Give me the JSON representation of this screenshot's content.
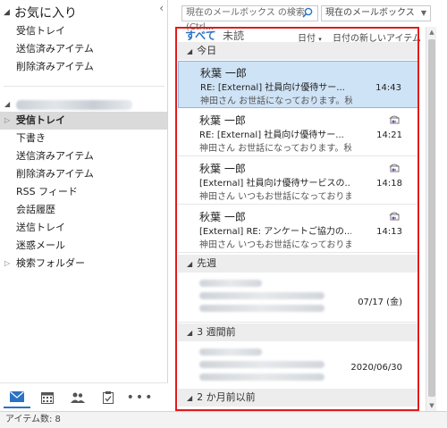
{
  "favorites": {
    "header": "お気に入り",
    "items": [
      "受信トレイ",
      "送信済みアイテム",
      "削除済みアイテム"
    ]
  },
  "folders": {
    "items": [
      "受信トレイ",
      "下書き",
      "送信済みアイテム",
      "削除済みアイテム",
      "RSS フィード",
      "会話履歴",
      "送信トレイ",
      "迷惑メール",
      "検索フォルダー"
    ],
    "selected_index": 0
  },
  "search": {
    "placeholder": "現在のメールボックス の検索 (Ctrl...",
    "scope": "現在のメールボックス"
  },
  "filters": {
    "all": "すべて",
    "unread": "未読",
    "sort_by": "日付",
    "order": "日付の新しいアイテム"
  },
  "groups": [
    "今日",
    "先週",
    "3 週間前",
    "2 か月前以前"
  ],
  "messages_today": [
    {
      "from": "秋葉 一郎",
      "subject": "RE: [External] 社員向け優待サー...",
      "preview": "神田さん お世話になっております。秋葉",
      "time": "14:43"
    },
    {
      "from": "秋葉 一郎",
      "subject": "RE: [External] 社員向け優待サー...",
      "preview": "神田さん お世話になっております。秋葉",
      "time": "14:21"
    },
    {
      "from": "秋葉 一郎",
      "subject": "[External] 社員向け優待サービスの...",
      "preview": "神田さん いつもお世話になっております。",
      "time": "14:18"
    },
    {
      "from": "秋葉 一郎",
      "subject": "[External] RE: アンケートご協力の...",
      "preview": "神田さん いつもお世話になっております。",
      "time": "14:13"
    }
  ],
  "messages_older": [
    {
      "time": "07/17 (金)"
    },
    {
      "time": "2020/06/30"
    }
  ],
  "status": {
    "item_count": "アイテム数: 8"
  },
  "colors": {
    "accent": "#2a72c6",
    "selection": "#cfe3f6",
    "highlight_frame": "#e21b1b"
  }
}
